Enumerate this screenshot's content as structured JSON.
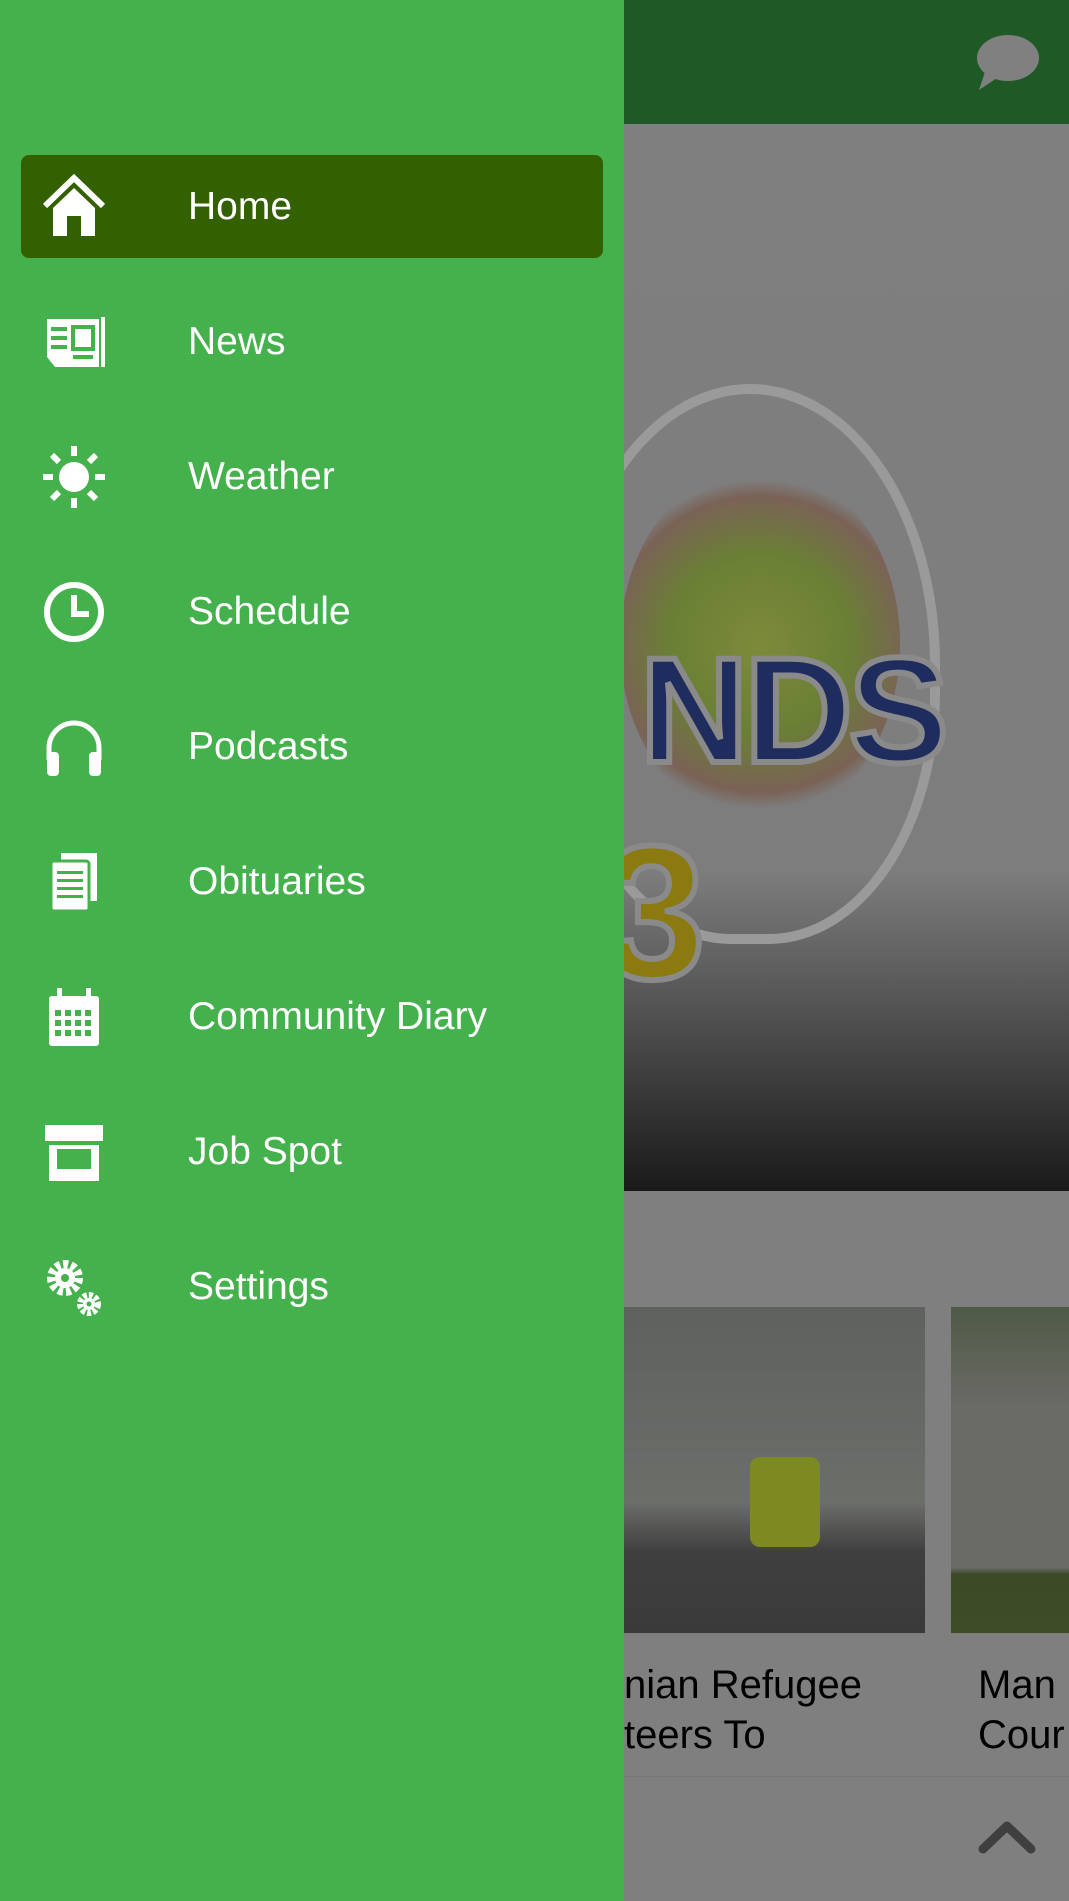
{
  "topbar": {
    "chat_icon": "chat-bubble-icon"
  },
  "hero": {
    "logo_text_1": "NDS",
    "logo_text_2": "3"
  },
  "cards": [
    {
      "title": "nian Refugee\nteers To"
    },
    {
      "title": "Man\nCour"
    }
  ],
  "bottombar": {
    "icon": "chevron-up-icon"
  },
  "drawer": {
    "items": [
      {
        "label": "Home",
        "icon": "home-icon",
        "active": true
      },
      {
        "label": "News",
        "icon": "newspaper-icon"
      },
      {
        "label": "Weather",
        "icon": "sun-icon"
      },
      {
        "label": "Schedule",
        "icon": "clock-icon"
      },
      {
        "label": "Podcasts",
        "icon": "headphones-icon"
      },
      {
        "label": "Obituaries",
        "icon": "document-icon"
      },
      {
        "label": "Community Diary",
        "icon": "calendar-icon"
      },
      {
        "label": "Job Spot",
        "icon": "storefront-icon"
      },
      {
        "label": "Settings",
        "icon": "gears-icon"
      }
    ]
  },
  "colors": {
    "drawer": "#44b14d",
    "active_item": "#336000",
    "topbar": "#1f5a26"
  }
}
